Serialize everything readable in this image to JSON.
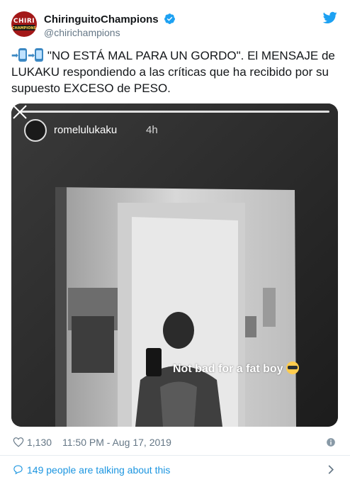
{
  "author": {
    "display_name": "ChiringuitoChampions",
    "handle": "@chirichampions",
    "avatar_line1": "CHIRI",
    "avatar_line2": "CHAMPIONS"
  },
  "tweet": {
    "text": "\"NO ESTÁ MAL PARA UN GORDO\". El MENSAJE de LUKAKU respondiendo a las críticas que ha recibido por su supuesto EXCESO de PESO."
  },
  "media": {
    "story_user": "romelulukaku",
    "story_time": "4h",
    "caption": "Not bad for a fat boy"
  },
  "meta": {
    "likes": "1,130",
    "timestamp": "11:50 PM - Aug 17, 2019"
  },
  "footer": {
    "talking": "149 people are talking about this"
  },
  "colors": {
    "link_blue": "#1b95e0",
    "muted_gray": "#657786",
    "text_dark": "#14171a",
    "verified_blue": "#1da1f2"
  },
  "icons": [
    "verified-badge-icon",
    "twitter-bird-icon",
    "phone-emoji-icon",
    "close-icon",
    "sunglasses-emoji-icon",
    "heart-icon",
    "info-icon",
    "chat-bubble-icon",
    "chevron-right-icon"
  ]
}
